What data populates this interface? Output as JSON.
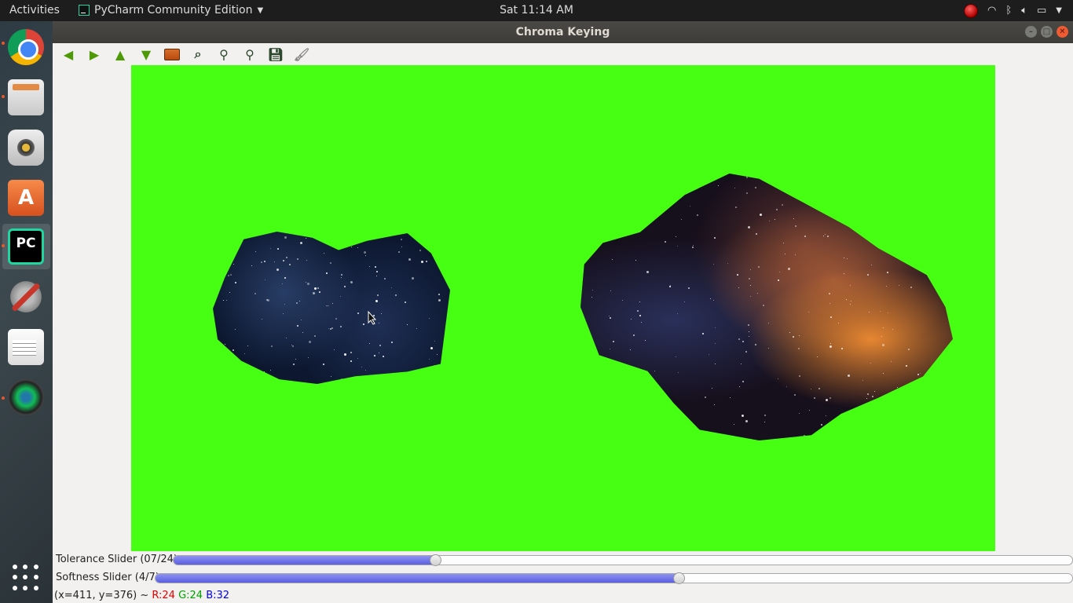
{
  "topbar": {
    "activities": "Activities",
    "app_name": "PyCharm Community Edition",
    "clock": "Sat 11:14 AM",
    "tray_icons": [
      "record-icon",
      "wifi-icon",
      "bluetooth-icon",
      "volume-icon",
      "battery-icon",
      "menu-arrow-icon"
    ]
  },
  "launcher": {
    "items": [
      "chrome",
      "files",
      "audio-player",
      "software-store",
      "pycharm",
      "settings",
      "text-editor",
      "camera-app",
      "show-applications"
    ]
  },
  "window": {
    "title": "Chroma Keying",
    "controls": [
      "minimize",
      "maximize",
      "close"
    ]
  },
  "toolbar": {
    "buttons": [
      "back-arrow-icon",
      "forward-arrow-icon",
      "up-arrow-icon",
      "down-arrow-icon",
      "image-icon",
      "zoom-fit-icon",
      "zoom-in-icon",
      "zoom-out-icon",
      "save-icon",
      "brush-icon"
    ]
  },
  "canvas": {
    "background_color": "#46ff12"
  },
  "sliders": {
    "tolerance": {
      "label": "Tolerance Slider (07/24)",
      "value": 7,
      "max": 24
    },
    "softness": {
      "label": "Softness Slider (4/7)",
      "value": 4,
      "max": 7
    }
  },
  "status": {
    "coords": "(x=411, y=376) ~ ",
    "r": "R:24",
    "g": "G:24",
    "b": "B:32"
  },
  "colors": {
    "slider_fill": "#5a5fe0",
    "status_r": "#e00000",
    "status_g": "#00a000",
    "status_b": "#0000e0"
  }
}
